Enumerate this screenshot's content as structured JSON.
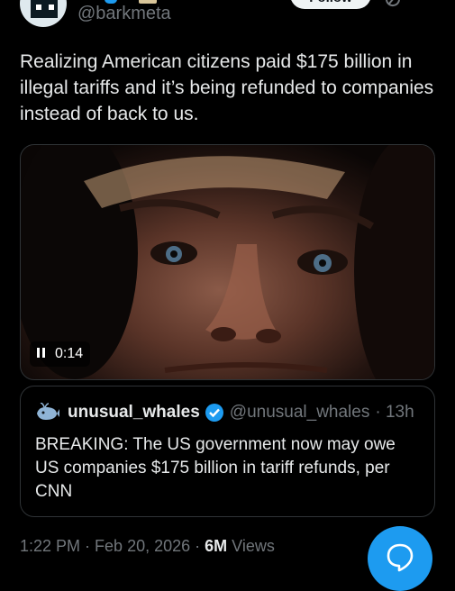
{
  "author": {
    "handle": "@barkmeta",
    "follow_label": "Follow"
  },
  "tweet": {
    "text": "Realizing American citizens paid $175 billion in illegal tariffs and it’s being refunded to companies instead of back to us."
  },
  "video": {
    "time": "0:14",
    "state": "playing"
  },
  "quote": {
    "name": "unusual_whales",
    "handle": "@unusual_whales",
    "age": "· 13h",
    "text": "BREAKING: The US government now may owe US companies $175 billion in tariff refunds, per CNN"
  },
  "meta": {
    "time": "1:22 PM",
    "date": "Feb 20, 2026",
    "views_count": "6M",
    "views_label": "Views"
  },
  "colors": {
    "accent": "#1d9bf0",
    "background": "#000000",
    "muted_text": "#71767b"
  },
  "icons": {
    "grok": "grok-icon",
    "pause": "pause-icon",
    "verified": "verified-badge-icon",
    "whale": "whale-icon",
    "compose": "chat-bubble-icon"
  }
}
